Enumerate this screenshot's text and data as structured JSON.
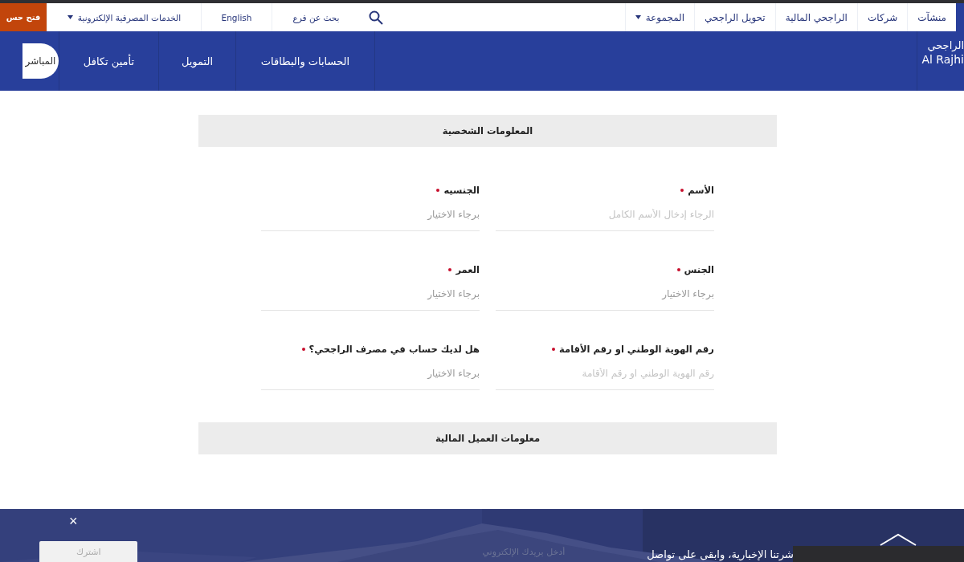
{
  "top_links": [
    {
      "label": "منشآت",
      "dropdown": false
    },
    {
      "label": "شركات",
      "dropdown": false
    },
    {
      "label": "الراجحي المالية",
      "dropdown": false
    },
    {
      "label": "تحويل الراجحي",
      "dropdown": false
    },
    {
      "label": "المجموعة",
      "dropdown": true
    }
  ],
  "utility_links": [
    {
      "label": "بحث عن فرع",
      "dropdown": false
    },
    {
      "label": "English",
      "dropdown": false
    },
    {
      "label": "الخدمات المصرفية الإلكترونية",
      "dropdown": true
    }
  ],
  "open_account_button": "فتح حس",
  "logo": {
    "arabic": "الراجحي",
    "english": "Al Rajhi"
  },
  "main_nav": [
    "الحسابات والبطاقات",
    "التمويل",
    "تأمين تكافل"
  ],
  "direct_button": "المباشر",
  "sections": [
    {
      "title": "المعلومات الشخصية",
      "fields": [
        {
          "label": "الأسم",
          "required": true,
          "kind": "text",
          "placeholder": "الرجاء إدخال الأسم الكامل"
        },
        {
          "label": "الجنسيه",
          "required": true,
          "kind": "select",
          "placeholder": "برجاء الاختيار"
        },
        {
          "label": "الجنس",
          "required": true,
          "kind": "select",
          "placeholder": "برجاء الاختيار"
        },
        {
          "label": "العمر",
          "required": true,
          "kind": "select",
          "placeholder": "برجاء الاختيار"
        },
        {
          "label": "رقم الهوية الوطني او رقم الأقامة",
          "required": true,
          "kind": "text",
          "placeholder": "رقم الهوية الوطني او رقم الأقامة"
        },
        {
          "label": "هل لديك حساب في مصرف الراجحي؟",
          "required": true,
          "kind": "select",
          "placeholder": "برجاء الاختيار"
        }
      ]
    },
    {
      "title": "معلومات العميل المالية"
    }
  ],
  "newsletter": {
    "text": "شرتنا الإخبارية، وابقى على تواصل",
    "email_placeholder": "أدخل بريدك الإلكتروني",
    "subscribe_button": "اشترك",
    "subscribe_disabled": true,
    "close": "×"
  }
}
